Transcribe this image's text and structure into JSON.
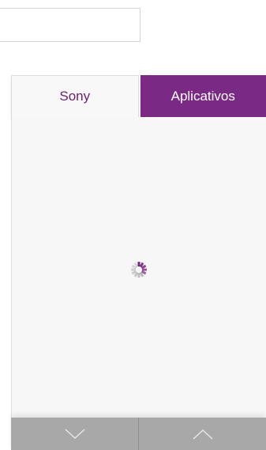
{
  "search": {
    "value": ""
  },
  "tabs": [
    {
      "label": "Sony",
      "active": false
    },
    {
      "label": "Aplicativos",
      "active": true
    }
  ],
  "content": {
    "status": "loading",
    "spinner_icon": "loading-spinner-icon"
  },
  "bottom_nav": {
    "down_icon": "chevron-down-icon",
    "up_icon": "chevron-up-icon"
  },
  "colors": {
    "accent": "#7a2a84",
    "tab_text": "#6b2074",
    "bottom_bar": "#a8a8a8"
  }
}
